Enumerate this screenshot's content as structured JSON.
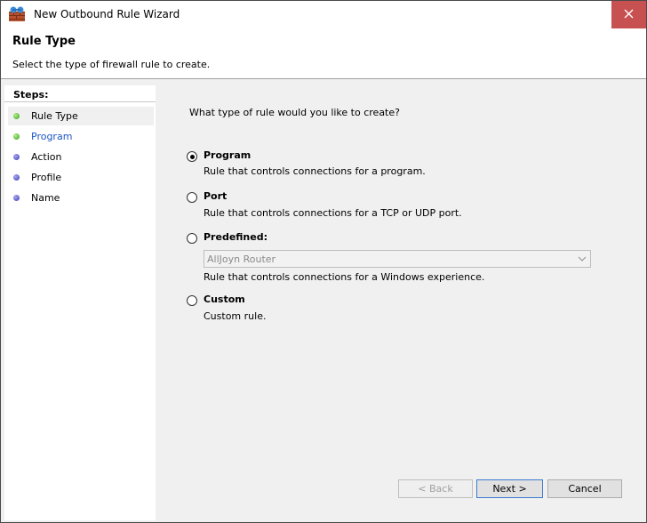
{
  "window": {
    "title": "New Outbound Rule Wizard"
  },
  "header": {
    "title": "Rule Type",
    "subtitle": "Select the type of firewall rule to create."
  },
  "steps": {
    "label": "Steps:",
    "items": [
      {
        "label": "Rule Type",
        "status": "complete",
        "dot_color": "#2e9f16"
      },
      {
        "label": "Program",
        "status": "link",
        "dot_color": "#2e9f16"
      },
      {
        "label": "Action",
        "status": "pending",
        "dot_color": "#3a3ab8"
      },
      {
        "label": "Profile",
        "status": "pending",
        "dot_color": "#3a3ab8"
      },
      {
        "label": "Name",
        "status": "pending",
        "dot_color": "#3a3ab8"
      }
    ]
  },
  "main": {
    "question": "What type of rule would you like to create?",
    "options": [
      {
        "label": "Program",
        "description": "Rule that controls connections for a program.",
        "selected": true
      },
      {
        "label": "Port",
        "description": "Rule that controls connections for a TCP or UDP port.",
        "selected": false
      },
      {
        "label": "Predefined:",
        "description": "Rule that controls connections for a Windows experience.",
        "selected": false
      },
      {
        "label": "Custom",
        "description": "Custom rule.",
        "selected": false
      }
    ],
    "predefined_select": {
      "value": "AllJoyn Router",
      "disabled": true
    }
  },
  "buttons": {
    "back": "< Back",
    "next": "Next >",
    "cancel": "Cancel"
  },
  "colors": {
    "close_button": "#c75050",
    "link": "#1c56c4",
    "step_complete": "#2e9f16",
    "step_pending": "#3a3ab8"
  },
  "icons": {
    "app": "firewall-icon",
    "close": "close-icon",
    "dropdown": "chevron-down-icon"
  }
}
